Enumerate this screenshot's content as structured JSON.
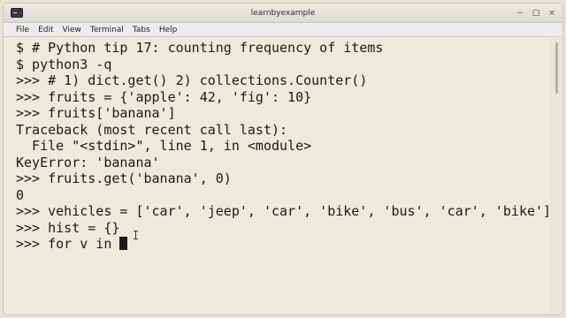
{
  "window": {
    "title": "learnbyexample",
    "icon": "terminal-icon",
    "controls": {
      "minimize": "−",
      "maximize": "□",
      "close": "×"
    }
  },
  "menu": {
    "items": [
      "File",
      "Edit",
      "View",
      "Terminal",
      "Tabs",
      "Help"
    ]
  },
  "terminal": {
    "lines": [
      "$ # Python tip 17: counting frequency of items",
      "$ python3 -q",
      ">>> # 1) dict.get() 2) collections.Counter()",
      ">>> fruits = {'apple': 42, 'fig': 10}",
      ">>> fruits['banana']",
      "Traceback (most recent call last):",
      "  File \"<stdin>\", line 1, in <module>",
      "KeyError: 'banana'",
      ">>> fruits.get('banana', 0)",
      "0",
      ">>> vehicles = ['car', 'jeep', 'car', 'bike', 'bus', 'car', 'bike']",
      ">>> hist = {}",
      ">>> for v in "
    ]
  },
  "colors": {
    "terminal_bg": "#ede9dc",
    "text": "#1a1a1a"
  }
}
